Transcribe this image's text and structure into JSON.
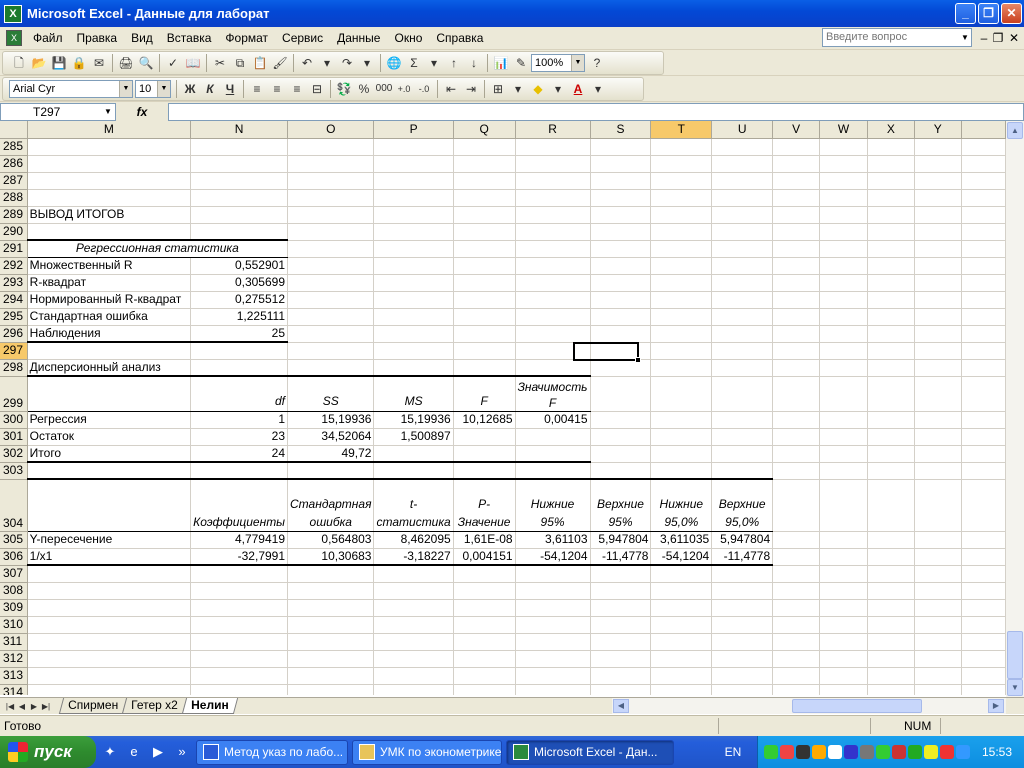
{
  "window": {
    "title": "Microsoft Excel - Данные для лаборат",
    "minimize": "_",
    "restore": "❐",
    "close": "✕"
  },
  "menu": {
    "items": [
      "Файл",
      "Правка",
      "Вид",
      "Вставка",
      "Формат",
      "Сервис",
      "Данные",
      "Окно",
      "Справка"
    ],
    "ask_placeholder": "Введите вопрос"
  },
  "toolbar": {
    "zoom": "100%"
  },
  "format_toolbar": {
    "font": "Arial Cyr",
    "size": "10",
    "bold": "Ж",
    "italic": "К",
    "underline": "Ч",
    "percent": "%",
    "thousands": "000",
    "font_color": "A"
  },
  "formula_bar": {
    "name_box": "T297",
    "fx": "fx",
    "formula": ""
  },
  "sheet": {
    "columns": [
      "M",
      "N",
      "O",
      "P",
      "Q",
      "R",
      "S",
      "T",
      "U",
      "V",
      "W",
      "X",
      "Y"
    ],
    "active_column": "T",
    "active_row": "297",
    "rows": {
      "r285": "285",
      "r286": "286",
      "r287": "287",
      "r288": "288",
      "r289": "289",
      "r290": "290",
      "r291": "291",
      "r292": "292",
      "r293": "293",
      "r294": "294",
      "r295": "295",
      "r296": "296",
      "r297": "297",
      "r298": "298",
      "r299": "299",
      "r300": "300",
      "r301": "301",
      "r302": "302",
      "r303": "303",
      "r304": "304",
      "r305": "305",
      "r306": "306",
      "r307": "307",
      "r308": "308",
      "r309": "309",
      "r310": "310",
      "r311": "311",
      "r312": "312",
      "r313": "313",
      "r314": "314"
    },
    "summary_title": "ВЫВОД ИТОГОВ",
    "regression_stats": {
      "header": "Регрессионная статистика",
      "rows": [
        {
          "label": "Множественный R",
          "value": "0,552901"
        },
        {
          "label": "R-квадрат",
          "value": "0,305699"
        },
        {
          "label": "Нормированный R-квадрат",
          "value": "0,275512"
        },
        {
          "label": "Стандартная ошибка",
          "value": "1,225111"
        },
        {
          "label": "Наблюдения",
          "value": "25"
        }
      ]
    },
    "anova": {
      "title": "Дисперсионный анализ",
      "headers": [
        "df",
        "SS",
        "MS",
        "F",
        "Значимость F"
      ],
      "rows": [
        {
          "label": "Регрессия",
          "df": "1",
          "ss": "15,19936",
          "ms": "15,19936",
          "f": "10,12685",
          "sig": "0,00415"
        },
        {
          "label": "Остаток",
          "df": "23",
          "ss": "34,52064",
          "ms": "1,500897",
          "f": "",
          "sig": ""
        },
        {
          "label": "Итого",
          "df": "24",
          "ss": "49,72",
          "ms": "",
          "f": "",
          "sig": ""
        }
      ]
    },
    "coefficients": {
      "headers": [
        "Коэффициенты",
        "Стандартная ошибка",
        "t-статистика",
        "P-Значение",
        "Нижние 95%",
        "Верхние 95%",
        "Нижние 95,0%",
        "Верхние 95,0%"
      ],
      "rows": [
        {
          "label": "Y-пересечение",
          "values": [
            "4,779419",
            "0,564803",
            "8,462095",
            "1,61E-08",
            "3,61103",
            "5,947804",
            "3,611035",
            "5,947804"
          ]
        },
        {
          "label": "1/x1",
          "values": [
            "-32,7991",
            "10,30683",
            "-3,18227",
            "0,004151",
            "-54,1204",
            "-11,4778",
            "-54,1204",
            "-11,4778"
          ]
        }
      ]
    }
  },
  "tabs": [
    "Спирмен",
    "Гетер x2",
    "Нелин"
  ],
  "active_tab": "Нелин",
  "status": {
    "ready": "Готово",
    "num": "NUM"
  },
  "taskbar": {
    "start": "пуск",
    "tasks": [
      "Метод указ по лабо...",
      "УМК по эконометрике",
      "Microsoft Excel - Дан..."
    ],
    "lang": "EN",
    "clock": "15:53"
  },
  "colors": {
    "title_blue": "#0349d6",
    "chrome": "#ece9d8",
    "active_header": "#f7c96a",
    "taskbar_blue": "#245edb",
    "start_green": "#2e8b2e"
  }
}
